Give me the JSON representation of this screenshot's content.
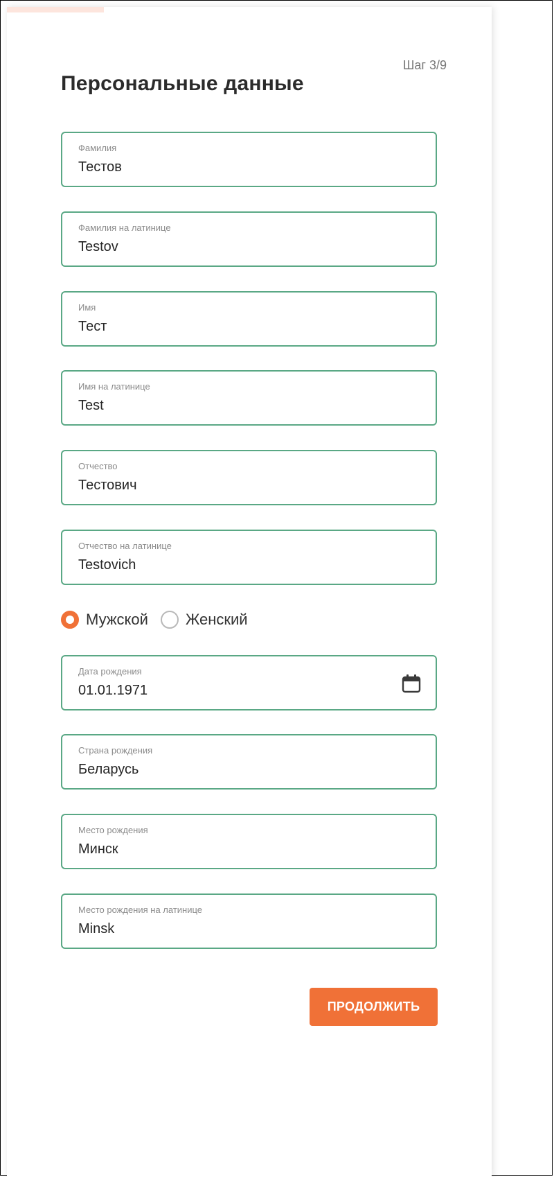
{
  "header": {
    "step": "Шаг 3/9",
    "title": "Персональные данные",
    "progress_fraction": 0.2
  },
  "fields": [
    {
      "label": "Фамилия",
      "value": "Тестов"
    },
    {
      "label": "Фамилия на латинице",
      "value": "Testov"
    },
    {
      "label": "Имя",
      "value": "Тест"
    },
    {
      "label": "Имя на латинице",
      "value": "Test"
    },
    {
      "label": "Отчество",
      "value": "Тестович"
    },
    {
      "label": "Отчество на латинице",
      "value": "Testovich"
    },
    {
      "label": "Дата рождения",
      "value": "01.01.1971",
      "icon": "calendar-icon"
    },
    {
      "label": "Страна рождения",
      "value": "Беларусь"
    },
    {
      "label": "Место рождения",
      "value": "Минск"
    },
    {
      "label": "Место рождения на латинице",
      "value": "Minsk"
    }
  ],
  "gender": {
    "options": [
      {
        "label": "Мужской",
        "checked": true
      },
      {
        "label": "Женский",
        "checked": false
      }
    ]
  },
  "actions": {
    "continue_label": "ПРОДОЛЖИТЬ"
  },
  "colors": {
    "accent": "#f07137",
    "field_border": "#5aa885",
    "progress": "#fde5dd"
  }
}
